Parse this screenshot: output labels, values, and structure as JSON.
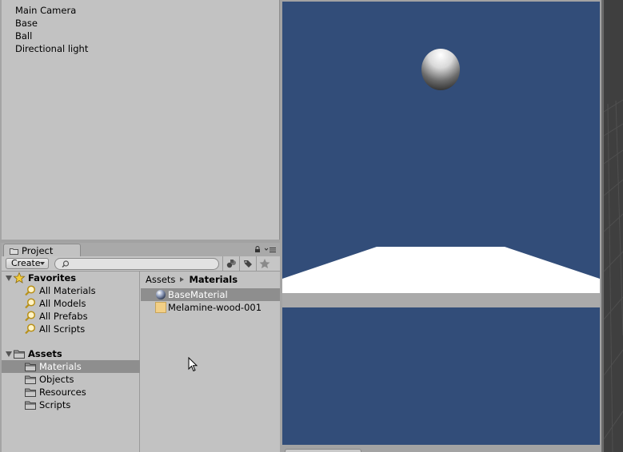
{
  "hierarchy": {
    "items": [
      "Main Camera",
      "Base",
      "Ball",
      "Directional light"
    ]
  },
  "project": {
    "tab_label": "Project",
    "create_label": "Create",
    "search_placeholder": "",
    "tree": {
      "favorites_label": "Favorites",
      "favorites": [
        "All Materials",
        "All Models",
        "All Prefabs",
        "All Scripts"
      ],
      "assets_label": "Assets",
      "folders": [
        "Materials",
        "Objects",
        "Resources",
        "Scripts"
      ],
      "selected_folder": "Materials"
    },
    "breadcrumb": [
      "Assets",
      "Materials"
    ],
    "assets": [
      {
        "name": "BaseMaterial",
        "icon": "material-sphere-icon",
        "selected": true
      },
      {
        "name": "Melamine-wood-001",
        "icon": "texture-icon",
        "selected": false
      }
    ]
  },
  "colors": {
    "panel_bg": "#c2c2c2",
    "selection": "#8e8e8e",
    "game_bg": "#324d79",
    "floor": "#ffffff",
    "floor_edge": "#aaaaaa",
    "dark_view": "#3f3f3f"
  }
}
